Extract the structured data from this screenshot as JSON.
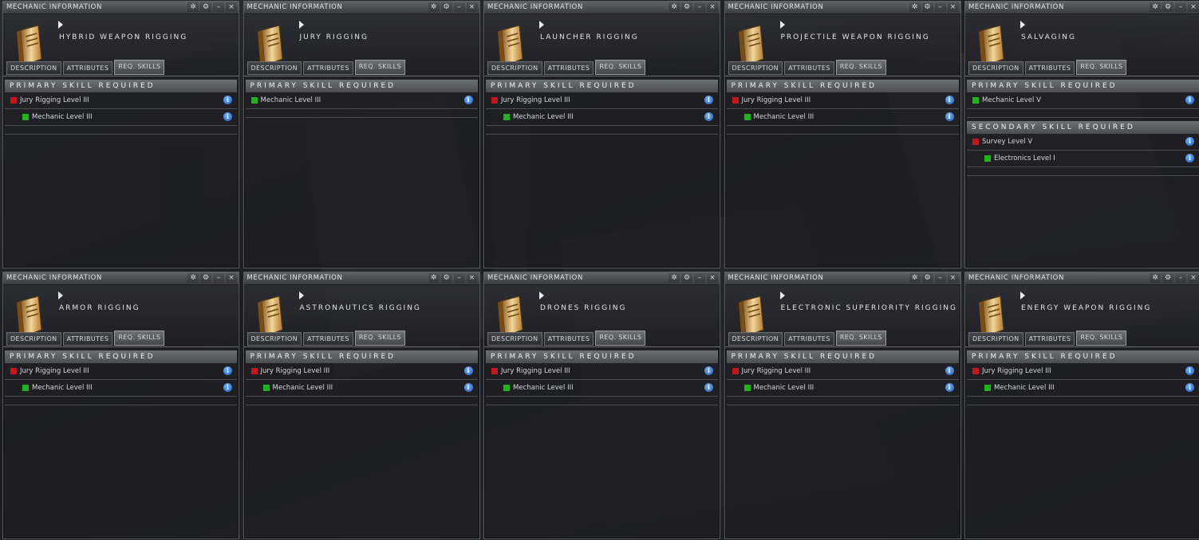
{
  "colors": {
    "missing": "#c4161c",
    "trained": "#1fb41f",
    "info": "#2f7fe0"
  },
  "windows": [
    {
      "title": "MECHANIC INFORMATION",
      "item": "HYBRID WEAPON RIGGING",
      "tabs": [
        "DESCRIPTION",
        "ATTRIBUTES",
        "REQ. SKILLS"
      ],
      "sections": [
        {
          "heading": "PRIMARY SKILL REQUIRED",
          "rows": [
            {
              "label": "Jury Rigging Level III",
              "status": "missing",
              "indent": 0
            },
            {
              "label": "Mechanic Level III",
              "status": "trained",
              "indent": 1
            }
          ]
        }
      ]
    },
    {
      "title": "MECHANIC INFORMATION",
      "item": "JURY RIGGING",
      "tabs": [
        "DESCRIPTION",
        "ATTRIBUTES",
        "REQ. SKILLS"
      ],
      "sections": [
        {
          "heading": "PRIMARY SKILL REQUIRED",
          "rows": [
            {
              "label": "Mechanic Level III",
              "status": "trained",
              "indent": 0
            }
          ]
        }
      ]
    },
    {
      "title": "MECHANIC INFORMATION",
      "item": "LAUNCHER RIGGING",
      "tabs": [
        "DESCRIPTION",
        "ATTRIBUTES",
        "REQ. SKILLS"
      ],
      "sections": [
        {
          "heading": "PRIMARY SKILL REQUIRED",
          "rows": [
            {
              "label": "Jury Rigging Level III",
              "status": "missing",
              "indent": 0
            },
            {
              "label": "Mechanic Level III",
              "status": "trained",
              "indent": 1
            }
          ]
        }
      ]
    },
    {
      "title": "MECHANIC INFORMATION",
      "item": "PROJECTILE WEAPON RIGGING",
      "tabs": [
        "DESCRIPTION",
        "ATTRIBUTES",
        "REQ. SKILLS"
      ],
      "sections": [
        {
          "heading": "PRIMARY SKILL REQUIRED",
          "rows": [
            {
              "label": "Jury Rigging Level III",
              "status": "missing",
              "indent": 0
            },
            {
              "label": "Mechanic Level III",
              "status": "trained",
              "indent": 1
            }
          ]
        }
      ]
    },
    {
      "title": "MECHANIC INFORMATION",
      "item": "SALVAGING",
      "tabs": [
        "DESCRIPTION",
        "ATTRIBUTES",
        "REQ. SKILLS"
      ],
      "sections": [
        {
          "heading": "PRIMARY SKILL REQUIRED",
          "rows": [
            {
              "label": "Mechanic Level V",
              "status": "trained",
              "indent": 0
            }
          ]
        },
        {
          "heading": "SECONDARY SKILL REQUIRED",
          "rows": [
            {
              "label": "Survey Level V",
              "status": "missing",
              "indent": 0
            },
            {
              "label": "Electronics Level I",
              "status": "trained",
              "indent": 1
            }
          ]
        }
      ]
    },
    {
      "title": "MECHANIC INFORMATION",
      "item": "ARMOR RIGGING",
      "tabs": [
        "DESCRIPTION",
        "ATTRIBUTES",
        "REQ. SKILLS"
      ],
      "sections": [
        {
          "heading": "PRIMARY SKILL REQUIRED",
          "rows": [
            {
              "label": "Jury Rigging Level III",
              "status": "missing",
              "indent": 0
            },
            {
              "label": "Mechanic Level III",
              "status": "trained",
              "indent": 1
            }
          ]
        }
      ]
    },
    {
      "title": "MECHANIC INFORMATION",
      "item": "ASTRONAUTICS RIGGING",
      "tabs": [
        "DESCRIPTION",
        "ATTRIBUTES",
        "REQ. SKILLS"
      ],
      "sections": [
        {
          "heading": "PRIMARY SKILL REQUIRED",
          "rows": [
            {
              "label": "Jury Rigging Level III",
              "status": "missing",
              "indent": 0
            },
            {
              "label": "Mechanic Level III",
              "status": "trained",
              "indent": 1
            }
          ]
        }
      ]
    },
    {
      "title": "MECHANIC INFORMATION",
      "item": "DRONES RIGGING",
      "tabs": [
        "DESCRIPTION",
        "ATTRIBUTES",
        "REQ. SKILLS"
      ],
      "sections": [
        {
          "heading": "PRIMARY SKILL REQUIRED",
          "rows": [
            {
              "label": "Jury Rigging Level III",
              "status": "missing",
              "indent": 0
            },
            {
              "label": "Mechanic Level III",
              "status": "trained",
              "indent": 1
            }
          ]
        }
      ]
    },
    {
      "title": "MECHANIC INFORMATION",
      "item": "ELECTRONIC SUPERIORITY RIGGING",
      "tabs": [
        "DESCRIPTION",
        "ATTRIBUTES",
        "REQ. SKILLS"
      ],
      "sections": [
        {
          "heading": "PRIMARY SKILL REQUIRED",
          "rows": [
            {
              "label": "Jury Rigging Level III",
              "status": "missing",
              "indent": 0
            },
            {
              "label": "Mechanic Level III",
              "status": "trained",
              "indent": 1
            }
          ]
        }
      ]
    },
    {
      "title": "MECHANIC INFORMATION",
      "item": "ENERGY WEAPON RIGGING",
      "tabs": [
        "DESCRIPTION",
        "ATTRIBUTES",
        "REQ. SKILLS"
      ],
      "sections": [
        {
          "heading": "PRIMARY SKILL REQUIRED",
          "rows": [
            {
              "label": "Jury Rigging Level III",
              "status": "missing",
              "indent": 0
            },
            {
              "label": "Mechanic Level III",
              "status": "trained",
              "indent": 1
            }
          ]
        }
      ]
    }
  ],
  "controls": {
    "pin": "✲",
    "settings": "⚙",
    "minimize": "–",
    "close": "×",
    "info": "i"
  }
}
